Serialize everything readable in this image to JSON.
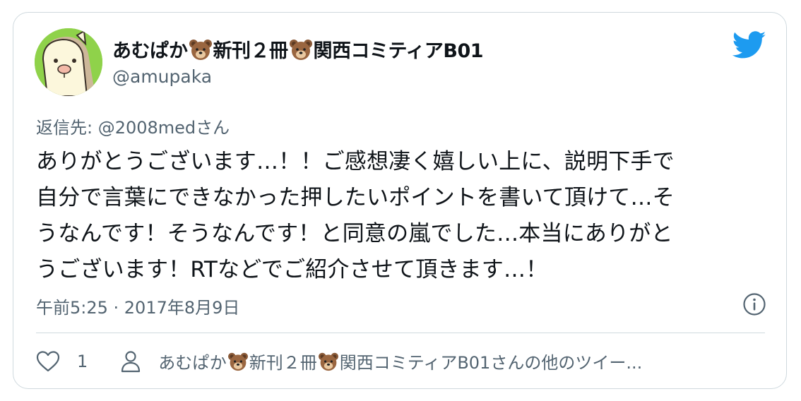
{
  "tweet": {
    "author": {
      "name_parts": [
        "あむぱか",
        "新刊２冊",
        "関西コミティアB01"
      ],
      "name_icon": "bear-face-icon",
      "handle": "@amupaka",
      "avatar": "avatar"
    },
    "reply_to": "返信先: @2008medさん",
    "text": "ありがとうございます…！！ご感想凄く嬉しい上に、説明下手で\n自分で言葉にできなかった押したいポイントを書いて頂けて…そ\nうなんです！そうなんです！と同意の嵐でした…本当にありがと\nうございます！RTなどでご紹介させて頂きます…！",
    "timestamp": "午前5:25 · 2017年8月9日",
    "likes": "1",
    "more_tweets_parts": [
      "あむぱか",
      "新刊２冊",
      "関西コミティアB01さんの他のツイー..."
    ]
  },
  "colors": {
    "brand": "#1d9bf0",
    "secondary_text": "#536471",
    "border": "#cfd9de"
  },
  "icons": {
    "logo": "twitter-bird-icon",
    "info": "info-icon",
    "like": "heart-icon",
    "profile": "person-icon"
  }
}
